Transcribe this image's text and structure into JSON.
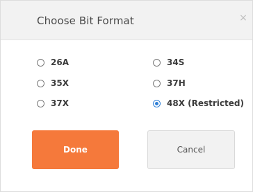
{
  "dialog": {
    "title": "Choose Bit Format",
    "close_glyph": "×",
    "options": [
      {
        "label": "26A",
        "selected": false
      },
      {
        "label": "34S",
        "selected": false
      },
      {
        "label": "35X",
        "selected": false
      },
      {
        "label": "37H",
        "selected": false
      },
      {
        "label": "37X",
        "selected": false
      },
      {
        "label": "48X (Restricted)",
        "selected": true
      }
    ],
    "done_label": "Done",
    "cancel_label": "Cancel"
  },
  "colors": {
    "accent": "#f5793b",
    "radio_selected": "#2f7fd6"
  }
}
